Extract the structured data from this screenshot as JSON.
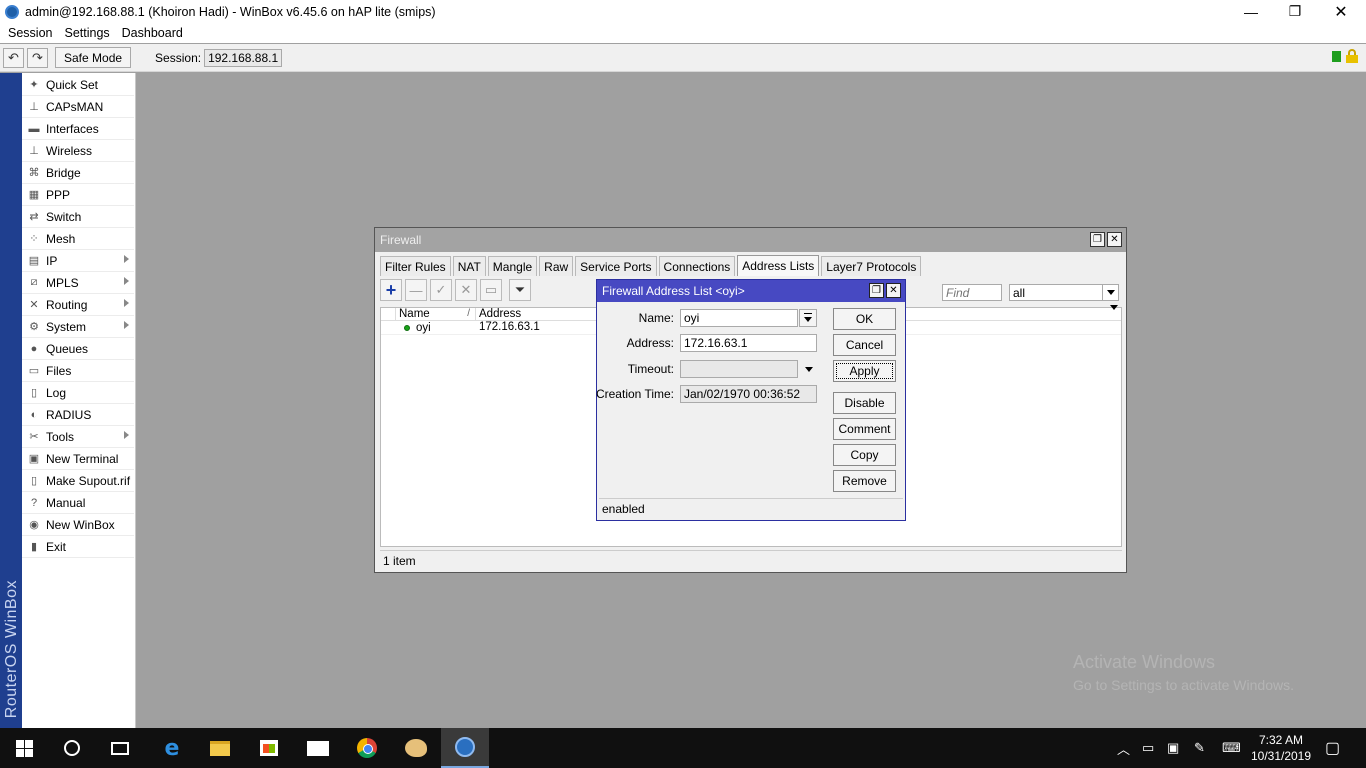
{
  "window": {
    "title": "admin@192.168.88.1 (Khoiron Hadi) - WinBox v6.45.6 on hAP lite (smips)",
    "min_symbol": "—",
    "max_symbol": "❐",
    "close_symbol": "✕"
  },
  "menubar": {
    "items": [
      "Session",
      "Settings",
      "Dashboard"
    ]
  },
  "toolbar": {
    "undo_symbol": "↶",
    "redo_symbol": "↷",
    "safe_mode_label": "Safe Mode",
    "session_label": "Session:",
    "session_value": "192.168.88.1"
  },
  "sidebar": {
    "brand": "RouterOS WinBox",
    "items": [
      {
        "label": "Quick Set",
        "icon": "quick-set-icon",
        "glyph": "✦",
        "submenu": false
      },
      {
        "label": "CAPsMAN",
        "icon": "capsman-icon",
        "glyph": "⊥",
        "submenu": false
      },
      {
        "label": "Interfaces",
        "icon": "interfaces-icon",
        "glyph": "▬",
        "submenu": false
      },
      {
        "label": "Wireless",
        "icon": "wireless-icon",
        "glyph": "⊥",
        "submenu": false
      },
      {
        "label": "Bridge",
        "icon": "bridge-icon",
        "glyph": "⌘",
        "submenu": false
      },
      {
        "label": "PPP",
        "icon": "ppp-icon",
        "glyph": "▦",
        "submenu": false
      },
      {
        "label": "Switch",
        "icon": "switch-icon",
        "glyph": "⇄",
        "submenu": false
      },
      {
        "label": "Mesh",
        "icon": "mesh-icon",
        "glyph": "⁘",
        "submenu": false
      },
      {
        "label": "IP",
        "icon": "ip-icon",
        "glyph": "▤",
        "submenu": true
      },
      {
        "label": "MPLS",
        "icon": "mpls-icon",
        "glyph": "⧄",
        "submenu": true
      },
      {
        "label": "Routing",
        "icon": "routing-icon",
        "glyph": "✕",
        "submenu": true
      },
      {
        "label": "System",
        "icon": "system-icon",
        "glyph": "⚙",
        "submenu": true
      },
      {
        "label": "Queues",
        "icon": "queues-icon",
        "glyph": "●",
        "submenu": false
      },
      {
        "label": "Files",
        "icon": "files-icon",
        "glyph": "▭",
        "submenu": false
      },
      {
        "label": "Log",
        "icon": "log-icon",
        "glyph": "▯",
        "submenu": false
      },
      {
        "label": "RADIUS",
        "icon": "radius-icon",
        "glyph": "◐",
        "submenu": false
      },
      {
        "label": "Tools",
        "icon": "tools-icon",
        "glyph": "✂",
        "submenu": true
      },
      {
        "label": "New Terminal",
        "icon": "terminal-icon",
        "glyph": "▣",
        "submenu": false
      },
      {
        "label": "Make Supout.rif",
        "icon": "supout-icon",
        "glyph": "▯",
        "submenu": false
      },
      {
        "label": "Manual",
        "icon": "manual-icon",
        "glyph": "?",
        "submenu": false
      },
      {
        "label": "New WinBox",
        "icon": "winbox-icon",
        "glyph": "◉",
        "submenu": false
      },
      {
        "label": "Exit",
        "icon": "exit-icon",
        "glyph": "▮",
        "submenu": false
      }
    ]
  },
  "firewall": {
    "title": "Firewall",
    "restore_symbol": "❐",
    "close_symbol": "✕",
    "tabs": [
      "Filter Rules",
      "NAT",
      "Mangle",
      "Raw",
      "Service Ports",
      "Connections",
      "Address Lists",
      "Layer7 Protocols"
    ],
    "active_tab": "Address Lists",
    "toolbar": {
      "add": "+",
      "remove": "—",
      "enable": "✓",
      "disable": "✕",
      "comment": "▭",
      "filter": "⏷"
    },
    "find_placeholder": "Find",
    "filter_value": "all",
    "columns": [
      "Name",
      "Address"
    ],
    "sort_marker": "/",
    "rows": [
      {
        "name": "oyi",
        "address": "172.16.63.1"
      }
    ],
    "status": "1 item"
  },
  "dialog": {
    "title": "Firewall Address List <oyi>",
    "restore_symbol": "❐",
    "close_symbol": "✕",
    "fields": {
      "name_label": "Name:",
      "name_value": "oyi",
      "address_label": "Address:",
      "address_value": "172.16.63.1",
      "timeout_label": "Timeout:",
      "timeout_value": "",
      "creation_label": "Creation Time:",
      "creation_value": "Jan/02/1970 00:36:52"
    },
    "buttons": [
      "OK",
      "Cancel",
      "Apply",
      "Disable",
      "Comment",
      "Copy",
      "Remove"
    ],
    "status": "enabled"
  },
  "watermark": {
    "line1": "Activate Windows",
    "line2": "Go to Settings to activate Windows."
  },
  "taskbar": {
    "edge_glyph": "e",
    "tray_up": "︿",
    "tray_battery": "▭",
    "tray_network": "▣",
    "tray_pen": "✎",
    "tray_keyboard": "⌨",
    "tray_notify": "▢",
    "time": "7:32 AM",
    "date": "10/31/2019"
  }
}
